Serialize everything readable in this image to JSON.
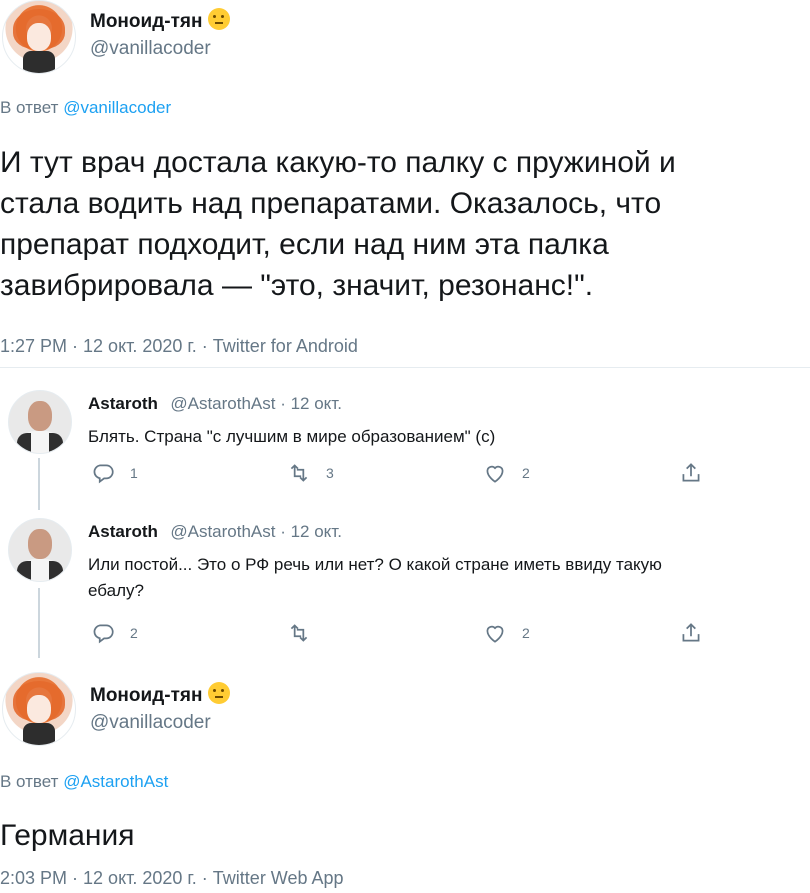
{
  "tweet1": {
    "name": "Моноид-тян",
    "handle": "@vanillacoder",
    "reply_prefix": "В ответ",
    "reply_handle": "@vanillacoder",
    "text_lines": [
      "И тут врач достала какую-то палку с пружиной и",
      "стала водить над препаратами. Оказалось, что",
      "препарат подходит, если над ним эта палка",
      "завибрировала — \"это, значит, резонанс!\"."
    ],
    "meta": "1:27 PM · 12 окт. 2020 г. · Twitter for Android"
  },
  "reply1": {
    "name": "Astaroth",
    "handle_date": "@AstarothAst · 12 окт.",
    "text": "Блять. Страна \"с лучшим в мире образованием\" (с)",
    "actions": {
      "reply_count": "1",
      "retweet_count": "3",
      "like_count": "2",
      "share_count": ""
    }
  },
  "reply2": {
    "name": "Astaroth",
    "handle_date": "@AstarothAst · 12 окт.",
    "text_lines": [
      "Или постой... Это о РФ речь или нет? О какой стране иметь ввиду такую",
      "ебалу?"
    ],
    "actions": {
      "reply_count": "2",
      "retweet_count": "",
      "like_count": "2",
      "share_count": ""
    }
  },
  "tweet2": {
    "name": "Моноид-тян",
    "handle": "@vanillacoder",
    "reply_prefix": "В ответ",
    "reply_handle": "@AstarothAst",
    "text": "Германия",
    "meta": "2:03 PM · 12 окт. 2020 г. · Twitter Web App"
  },
  "icons": {
    "reply": "reply-icon",
    "retweet": "retweet-icon",
    "like": "heart-icon",
    "share": "share-icon",
    "emoji": "thinking-face-emoji"
  }
}
